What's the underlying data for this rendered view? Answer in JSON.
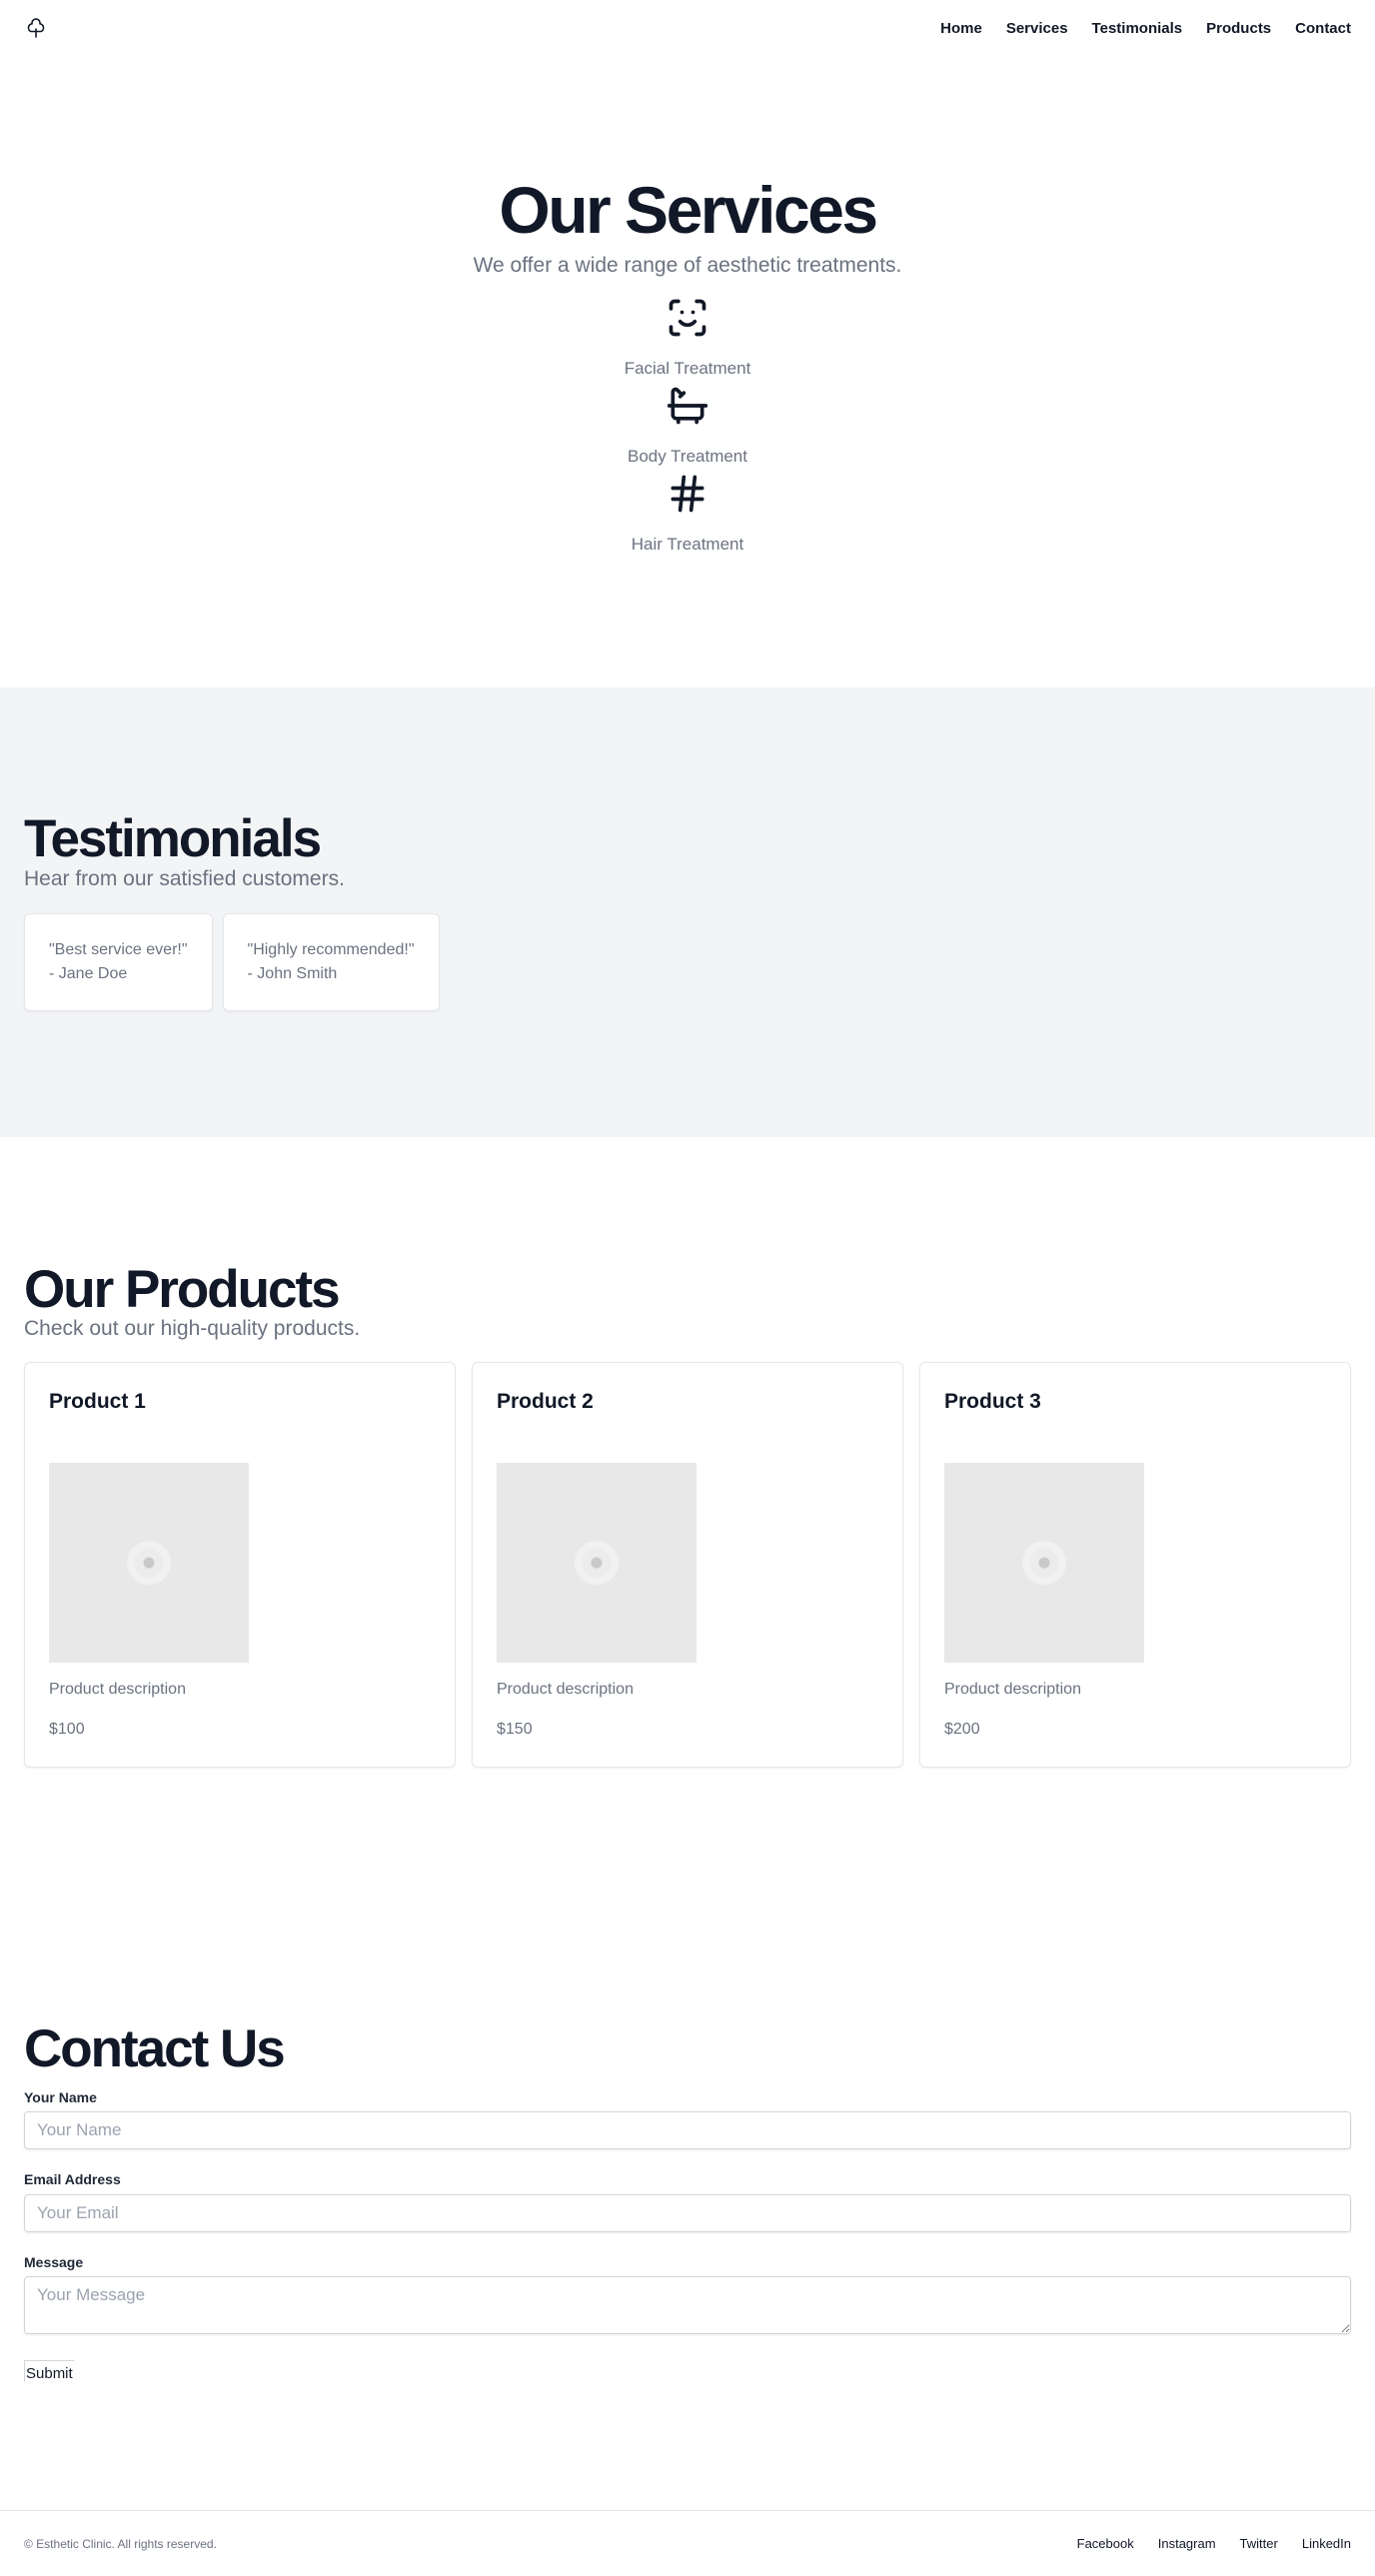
{
  "header": {
    "logo_icon": "cloud-icon",
    "nav": [
      {
        "label": "Home"
      },
      {
        "label": "Services"
      },
      {
        "label": "Testimonials"
      },
      {
        "label": "Products"
      },
      {
        "label": "Contact"
      }
    ]
  },
  "services": {
    "title": "Our Services",
    "subtitle": "We offer a wide range of aesthetic treatments.",
    "items": [
      {
        "label": "Facial Treatment",
        "icon": "face-scan-icon"
      },
      {
        "label": "Body Treatment",
        "icon": "bathtub-icon"
      },
      {
        "label": "Hair Treatment",
        "icon": "hash-icon"
      }
    ]
  },
  "testimonials": {
    "title": "Testimonials",
    "subtitle": "Hear from our satisfied customers.",
    "items": [
      {
        "quote": "\"Best service ever!\"",
        "author": "- Jane Doe"
      },
      {
        "quote": "\"Highly recommended!\"",
        "author": "- John Smith"
      }
    ]
  },
  "products": {
    "title": "Our Products",
    "subtitle": "Check out our high-quality products.",
    "items": [
      {
        "name": "Product 1",
        "description": "Product description",
        "price": "$100"
      },
      {
        "name": "Product 2",
        "description": "Product description",
        "price": "$150"
      },
      {
        "name": "Product 3",
        "description": "Product description",
        "price": "$200"
      }
    ]
  },
  "contact": {
    "title": "Contact Us",
    "name_label": "Your Name",
    "name_placeholder": "Your Name",
    "email_label": "Email Address",
    "email_placeholder": "Your Email",
    "message_label": "Message",
    "message_placeholder": "Your Message",
    "submit_label": "Submit"
  },
  "footer": {
    "copyright": "© Esthetic Clinic. All rights reserved.",
    "links": [
      {
        "label": "Facebook"
      },
      {
        "label": "Instagram"
      },
      {
        "label": "Twitter"
      },
      {
        "label": "LinkedIn"
      }
    ]
  }
}
